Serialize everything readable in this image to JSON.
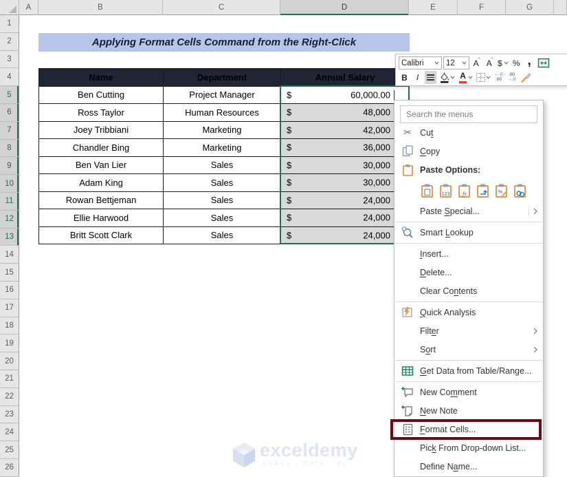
{
  "colors": {
    "accent_green": "#1e7145",
    "table_header_bg": "#1f2636",
    "banner_bg": "#b7c5e8",
    "selection_gray": "#d9d9d9",
    "format_cells_highlight": "#6c0a10"
  },
  "spreadsheet": {
    "column_headers": [
      "A",
      "B",
      "C",
      "D",
      "E",
      "F",
      "G"
    ],
    "selected_column": "D",
    "row_count": 26,
    "selected_rows": [
      5,
      6,
      7,
      8,
      9,
      10,
      11,
      12,
      13
    ],
    "title_banner": "Applying Format Cells Command from the Right-Click",
    "table": {
      "headers": [
        "Name",
        "Department",
        "Annual Salary"
      ],
      "currency_symbol": "$",
      "rows": [
        {
          "name": "Ben Cutting",
          "department": "Project Manager",
          "salary": "60,000.00"
        },
        {
          "name": "Ross Taylor",
          "department": "Human Resources",
          "salary": "48,000"
        },
        {
          "name": "Joey Tribbiani",
          "department": "Marketing",
          "salary": "42,000"
        },
        {
          "name": "Chandler Bing",
          "department": "Marketing",
          "salary": "36,000"
        },
        {
          "name": "Ben Van Lier",
          "department": "Sales",
          "salary": "30,000"
        },
        {
          "name": "Adam King",
          "department": "Sales",
          "salary": "30,000"
        },
        {
          "name": "Rowan Bettjeman",
          "department": "Sales",
          "salary": "24,000"
        },
        {
          "name": "Ellie Harwood",
          "department": "Sales",
          "salary": "24,000"
        },
        {
          "name": "Britt Scott Clark",
          "department": "Sales",
          "salary": "24,000"
        }
      ]
    }
  },
  "mini_toolbar": {
    "font_name": "Calibri",
    "font_size": "12",
    "grow_font_label": "A",
    "shrink_font_label": "A",
    "accounting_label": "$",
    "percent_label": "%",
    "comma_label": ",",
    "bold_label": "B",
    "italic_label": "I",
    "font_color_label": "A",
    "increase_decimal_top": "←.0",
    "increase_decimal_bottom": ".00",
    "decrease_decimal_top": ".00",
    "decrease_decimal_bottom": "→.0"
  },
  "context_menu": {
    "search_placeholder": "Search the menus",
    "cut": {
      "pre": "Cu",
      "key": "t",
      "post": ""
    },
    "copy": {
      "pre": "",
      "key": "C",
      "post": "opy"
    },
    "paste_options": {
      "label": "Paste Options:"
    },
    "paste_special": {
      "pre": "Paste ",
      "key": "S",
      "post": "pecial..."
    },
    "smart_lookup": {
      "pre": "Smart ",
      "key": "L",
      "post": "ookup"
    },
    "insert": {
      "pre": "",
      "key": "I",
      "post": "nsert..."
    },
    "delete": {
      "pre": "",
      "key": "D",
      "post": "elete..."
    },
    "clear_contents": {
      "pre": "Clear Co",
      "key": "n",
      "post": "tents"
    },
    "quick_analysis": {
      "pre": "",
      "key": "Q",
      "post": "uick Analysis"
    },
    "filter": {
      "pre": "Filt",
      "key": "e",
      "post": "r"
    },
    "sort": {
      "pre": "S",
      "key": "o",
      "post": "rt"
    },
    "get_data": {
      "pre": "",
      "key": "G",
      "post": "et Data from Table/Range..."
    },
    "new_comment": {
      "pre": "New Co",
      "key": "m",
      "post": "ment"
    },
    "new_note": {
      "pre": "",
      "key": "N",
      "post": "ew Note"
    },
    "format_cells": {
      "pre": "",
      "key": "F",
      "post": "ormat Cells..."
    },
    "pick_list": {
      "pre": "Pic",
      "key": "k",
      "post": " From Drop-down List..."
    },
    "define_name": {
      "pre": "Define N",
      "key": "a",
      "post": "me..."
    }
  },
  "watermark": {
    "brand": "exceldemy",
    "tagline": "EXCEL - DATA - BI"
  }
}
